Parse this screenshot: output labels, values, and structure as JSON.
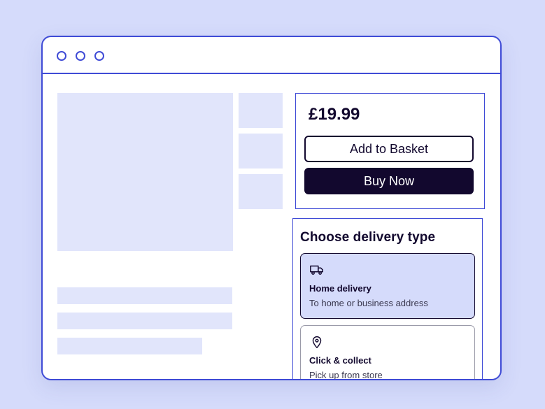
{
  "window": {
    "controls": [
      "window-dot-1",
      "window-dot-2",
      "window-dot-3"
    ]
  },
  "product": {
    "price": "£19.99",
    "add_to_basket_label": "Add to Basket",
    "buy_now_label": "Buy Now"
  },
  "delivery": {
    "title": "Choose delivery type",
    "options": [
      {
        "icon": "truck-icon",
        "title": "Home delivery",
        "subtitle": "To home or business address",
        "selected": true
      },
      {
        "icon": "location-pin-icon",
        "title": "Click & collect",
        "subtitle": "Pick up from store",
        "selected": false
      }
    ]
  },
  "colors": {
    "background": "#d5dbfb",
    "accent": "#3f4bd6",
    "dark": "#12082e",
    "placeholder": "#e1e5fb"
  }
}
